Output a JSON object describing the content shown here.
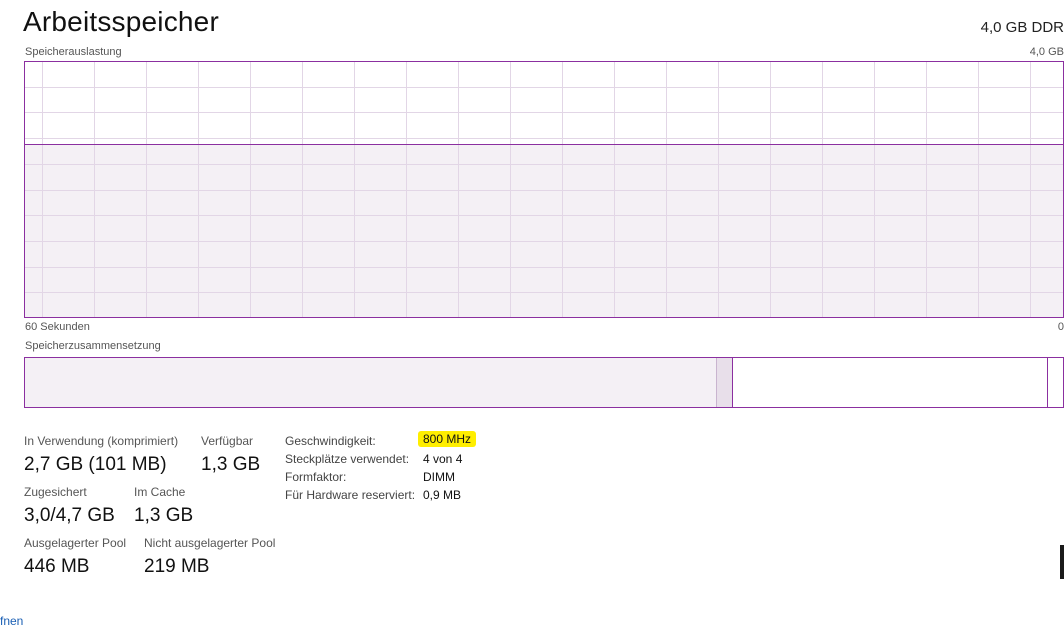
{
  "header": {
    "title": "Arbeitsspeicher",
    "spec": "4,0 GB DDR"
  },
  "usage_graph": {
    "label": "Speicherauslastung",
    "max_label": "4,0 GB",
    "time_left": "60 Sekunden",
    "time_right": "0",
    "colors": {
      "border": "#8b2fa0",
      "fill": "#f4f0f5",
      "grid": "#e2d6e6"
    }
  },
  "composition": {
    "label": "Speicherzusammensetzung"
  },
  "stats": {
    "in_use_label": "In Verwendung (komprimiert)",
    "in_use_value": "2,7 GB (101 MB)",
    "available_label": "Verfügbar",
    "available_value": "1,3 GB",
    "committed_label": "Zugesichert",
    "committed_value": "3,0/4,7 GB",
    "cached_label": "Im Cache",
    "cached_value": "1,3 GB",
    "paged_label": "Ausgelagerter Pool",
    "paged_value": "446 MB",
    "nonpaged_label": "Nicht ausgelagerter Pool",
    "nonpaged_value": "219 MB"
  },
  "details": {
    "speed_label": "Geschwindigkeit:",
    "speed_value": "800 MHz",
    "slots_label": "Steckplätze verwendet:",
    "slots_value": "4 von 4",
    "form_label": "Formfaktor:",
    "form_value": "DIMM",
    "reserved_label": "Für Hardware reserviert:",
    "reserved_value": "0,9 MB"
  },
  "footer": {
    "link_text": "fnen"
  }
}
